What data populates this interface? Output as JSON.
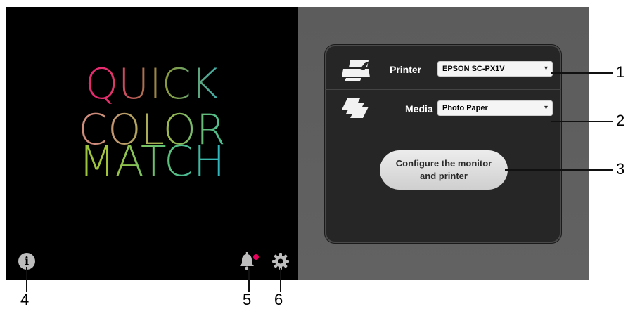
{
  "logo": {
    "line1": "QUICK",
    "line2": "COLOR",
    "line3": "MATCH"
  },
  "printer": {
    "label": "Printer",
    "selected": "EPSON SC-PX1V",
    "icon": "printer-icon"
  },
  "media": {
    "label": "Media",
    "selected": "Photo Paper",
    "icon": "media-paper-icon"
  },
  "configure_button": {
    "line1": "Configure the monitor",
    "line2": "and printer"
  },
  "bottom_icons": {
    "info": "info-icon",
    "notifications": "bell-icon",
    "settings": "gear-icon",
    "notification_dot_color": "#e6005c"
  },
  "callouts": [
    "1",
    "2",
    "3",
    "4",
    "5",
    "6"
  ]
}
